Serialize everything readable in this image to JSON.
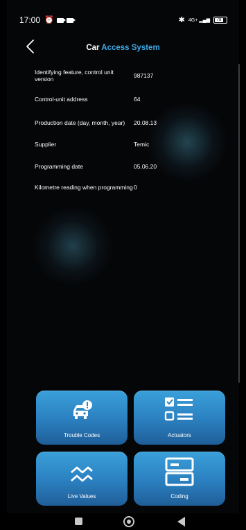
{
  "status_bar": {
    "time": "17:00",
    "network": "4G+",
    "battery": "78"
  },
  "header": {
    "title_part1": "Car",
    "title_part2": "Access System",
    "accent_color": "#3fa8e6"
  },
  "info_rows": [
    {
      "label": "Identifying feature, control unit version",
      "value": "987137"
    },
    {
      "label": "Control-unit address",
      "value": "64"
    },
    {
      "label": "Production date (day, month, year)",
      "value": "20.08.13"
    },
    {
      "label": "Supplier",
      "value": "Temic"
    },
    {
      "label": "Programming date",
      "value": "05.06.20"
    },
    {
      "label": "Kilometre reading when programming",
      "value": "0"
    }
  ],
  "tiles": {
    "trouble_codes": {
      "label": "Trouble Codes",
      "icon": "car-alert-icon"
    },
    "actuators": {
      "label": "Actuators",
      "icon": "checklist-icon"
    },
    "live_values": {
      "label": "Live Values",
      "icon": "wave-icon"
    },
    "coding": {
      "label": "Coding",
      "icon": "modules-icon"
    }
  }
}
